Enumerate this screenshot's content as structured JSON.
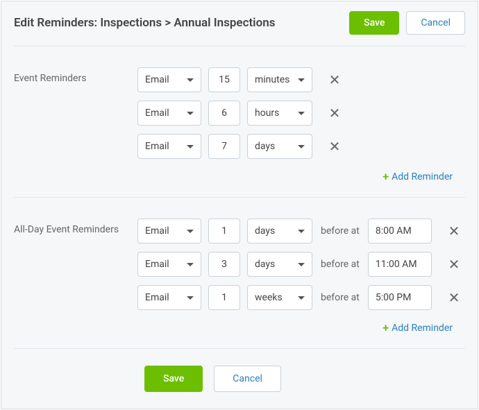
{
  "header": {
    "title": "Edit Reminders: Inspections > Annual Inspections",
    "save_label": "Save",
    "cancel_label": "Cancel"
  },
  "event_reminders": {
    "label": "Event Reminders",
    "rows": [
      {
        "method": "Email",
        "qty": "15",
        "unit": "minutes"
      },
      {
        "method": "Email",
        "qty": "6",
        "unit": "hours"
      },
      {
        "method": "Email",
        "qty": "7",
        "unit": "days"
      }
    ],
    "add_label": "Add Reminder"
  },
  "allday_reminders": {
    "label": "All-Day Event Reminders",
    "before_at_label": "before at",
    "rows": [
      {
        "method": "Email",
        "qty": "1",
        "unit": "days",
        "time": "8:00 AM"
      },
      {
        "method": "Email",
        "qty": "3",
        "unit": "days",
        "time": "11:00 AM"
      },
      {
        "method": "Email",
        "qty": "1",
        "unit": "weeks",
        "time": "5:00 PM"
      }
    ],
    "add_label": "Add Reminder"
  },
  "footer": {
    "save_label": "Save",
    "cancel_label": "Cancel"
  }
}
